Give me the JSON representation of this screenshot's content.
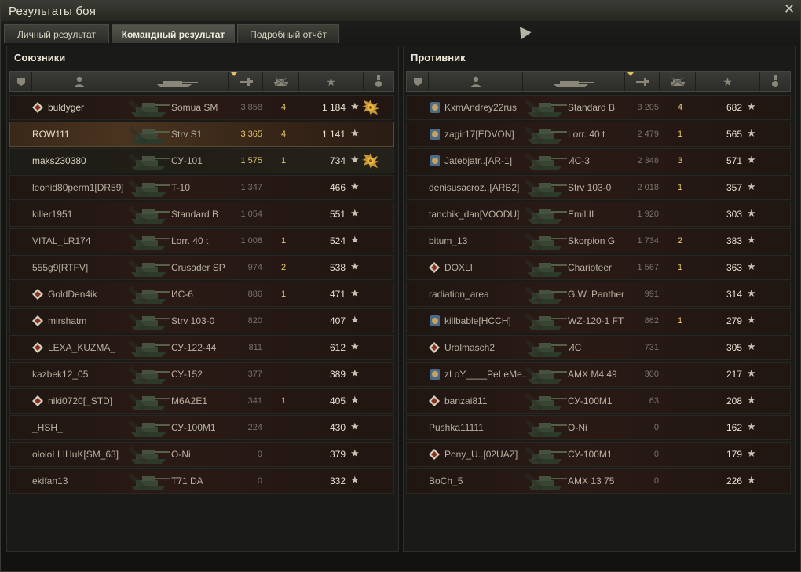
{
  "window": {
    "title": "Результаты боя"
  },
  "tabs": [
    {
      "label": "Личный результат",
      "active": false
    },
    {
      "label": "Командный результат",
      "active": true
    },
    {
      "label": "Подробный отчёт",
      "active": false
    }
  ],
  "columns": {
    "icons": [
      "platoon-icon",
      "player-icon",
      "tank-icon",
      "damage-icon",
      "kills-icon",
      "star-icon",
      "medal-icon"
    ]
  },
  "allies": {
    "title": "Союзники",
    "rows": [
      {
        "name": "buldyger",
        "vehicle": "Somua SM",
        "xp": "3 858",
        "kills": "4",
        "score": "1 184",
        "badge": "clan-badge-icon",
        "medal": "medal-icon"
      },
      {
        "name": "ROW111",
        "vehicle": "Strv S1",
        "xp": "3 365",
        "kills": "4",
        "score": "1 141",
        "self": true
      },
      {
        "name": "maks230380",
        "vehicle": "СУ-101",
        "xp": "1 575",
        "kills": "1",
        "score": "734",
        "medal": "medal-icon"
      },
      {
        "name": "leonid80perm1[DR59]",
        "vehicle": "T-10",
        "xp": "1 347",
        "kills": "",
        "score": "466"
      },
      {
        "name": "killer1951",
        "vehicle": "Standard B",
        "xp": "1 054",
        "kills": "",
        "score": "551"
      },
      {
        "name": "VITAL_LR174",
        "vehicle": "Lorr. 40 t",
        "xp": "1 008",
        "kills": "1",
        "score": "524"
      },
      {
        "name": "555g9[RTFV]",
        "vehicle": "Crusader SP",
        "xp": "974",
        "kills": "2",
        "score": "538"
      },
      {
        "name": "GoldDen4ik",
        "vehicle": "ИС-6",
        "xp": "886",
        "kills": "1",
        "score": "471",
        "badge": "clan-badge-icon"
      },
      {
        "name": "mirshatm",
        "vehicle": "Strv 103-0",
        "xp": "820",
        "kills": "",
        "score": "407",
        "badge": "clan-badge-icon"
      },
      {
        "name": "LEXA_KUZMA_",
        "vehicle": "СУ-122-44",
        "xp": "811",
        "kills": "",
        "score": "612",
        "badge": "clan-badge-icon"
      },
      {
        "name": "kazbek12_05",
        "vehicle": "СУ-152",
        "xp": "377",
        "kills": "",
        "score": "389"
      },
      {
        "name": "niki0720[_STD]",
        "vehicle": "M6A2E1",
        "xp": "341",
        "kills": "1",
        "score": "405",
        "badge": "clan-badge-icon"
      },
      {
        "name": "_HSH_",
        "vehicle": "СУ-100М1",
        "xp": "224",
        "kills": "",
        "score": "430"
      },
      {
        "name": "ololoLLIHuK[SM_63]",
        "vehicle": "O-Ni",
        "xp": "0",
        "kills": "",
        "score": "379"
      },
      {
        "name": "ekifan13",
        "vehicle": "T71 DA",
        "xp": "0",
        "kills": "",
        "score": "332"
      }
    ]
  },
  "enemies": {
    "title": "Противник",
    "rows": [
      {
        "name": "KxmAndrey22rus",
        "vehicle": "Standard B",
        "xp": "3 205",
        "kills": "4",
        "score": "682",
        "badge": "achievement-badge-icon"
      },
      {
        "name": "zagir17[EDVON]",
        "vehicle": "Lorr. 40 t",
        "xp": "2 479",
        "kills": "1",
        "score": "565",
        "badge": "achievement-badge-icon"
      },
      {
        "name": "Jatebjatr..[AR-1]",
        "vehicle": "ИС-3",
        "xp": "2 348",
        "kills": "3",
        "score": "571",
        "badge": "achievement-badge-icon"
      },
      {
        "name": "denisusacroz..[ARB2]",
        "vehicle": "Strv 103-0",
        "xp": "2 018",
        "kills": "1",
        "score": "357"
      },
      {
        "name": "tanchik_dan[VOODU]",
        "vehicle": "Emil II",
        "xp": "1 920",
        "kills": "",
        "score": "303"
      },
      {
        "name": "bitum_13",
        "vehicle": "Skorpion G",
        "xp": "1 734",
        "kills": "2",
        "score": "383"
      },
      {
        "name": "DOXLI",
        "vehicle": "Charioteer",
        "xp": "1 567",
        "kills": "1",
        "score": "363",
        "badge": "clan-badge-icon"
      },
      {
        "name": "radiation_area",
        "vehicle": "G.W. Panther",
        "xp": "991",
        "kills": "",
        "score": "314"
      },
      {
        "name": "killbable[HCCH]",
        "vehicle": "WZ-120-1 FT",
        "xp": "862",
        "kills": "1",
        "score": "279",
        "badge": "achievement-badge-icon"
      },
      {
        "name": "Uralmasch2",
        "vehicle": "ИС",
        "xp": "731",
        "kills": "",
        "score": "305",
        "badge": "clan-badge-icon"
      },
      {
        "name": "zLoY____PeLeMe..",
        "vehicle": "AMX M4 49",
        "xp": "300",
        "kills": "",
        "score": "217",
        "badge": "achievement-badge-icon"
      },
      {
        "name": "banzai811",
        "vehicle": "СУ-100М1",
        "xp": "63",
        "kills": "",
        "score": "208",
        "badge": "clan-badge-icon"
      },
      {
        "name": "Pushka11111",
        "vehicle": "O-Ni",
        "xp": "0",
        "kills": "",
        "score": "162"
      },
      {
        "name": "Pony_U..[02UAZ]",
        "vehicle": "СУ-100М1",
        "xp": "0",
        "kills": "",
        "score": "179",
        "badge": "clan-badge-icon"
      },
      {
        "name": "BoCh_5",
        "vehicle": "AMX 13 75",
        "xp": "0",
        "kills": "",
        "score": "226"
      }
    ]
  },
  "colors": {
    "accent": "#e6c56a",
    "text": "#b8b2a2",
    "row_bg": "#2a1a16",
    "self_row": "#4a3420"
  }
}
